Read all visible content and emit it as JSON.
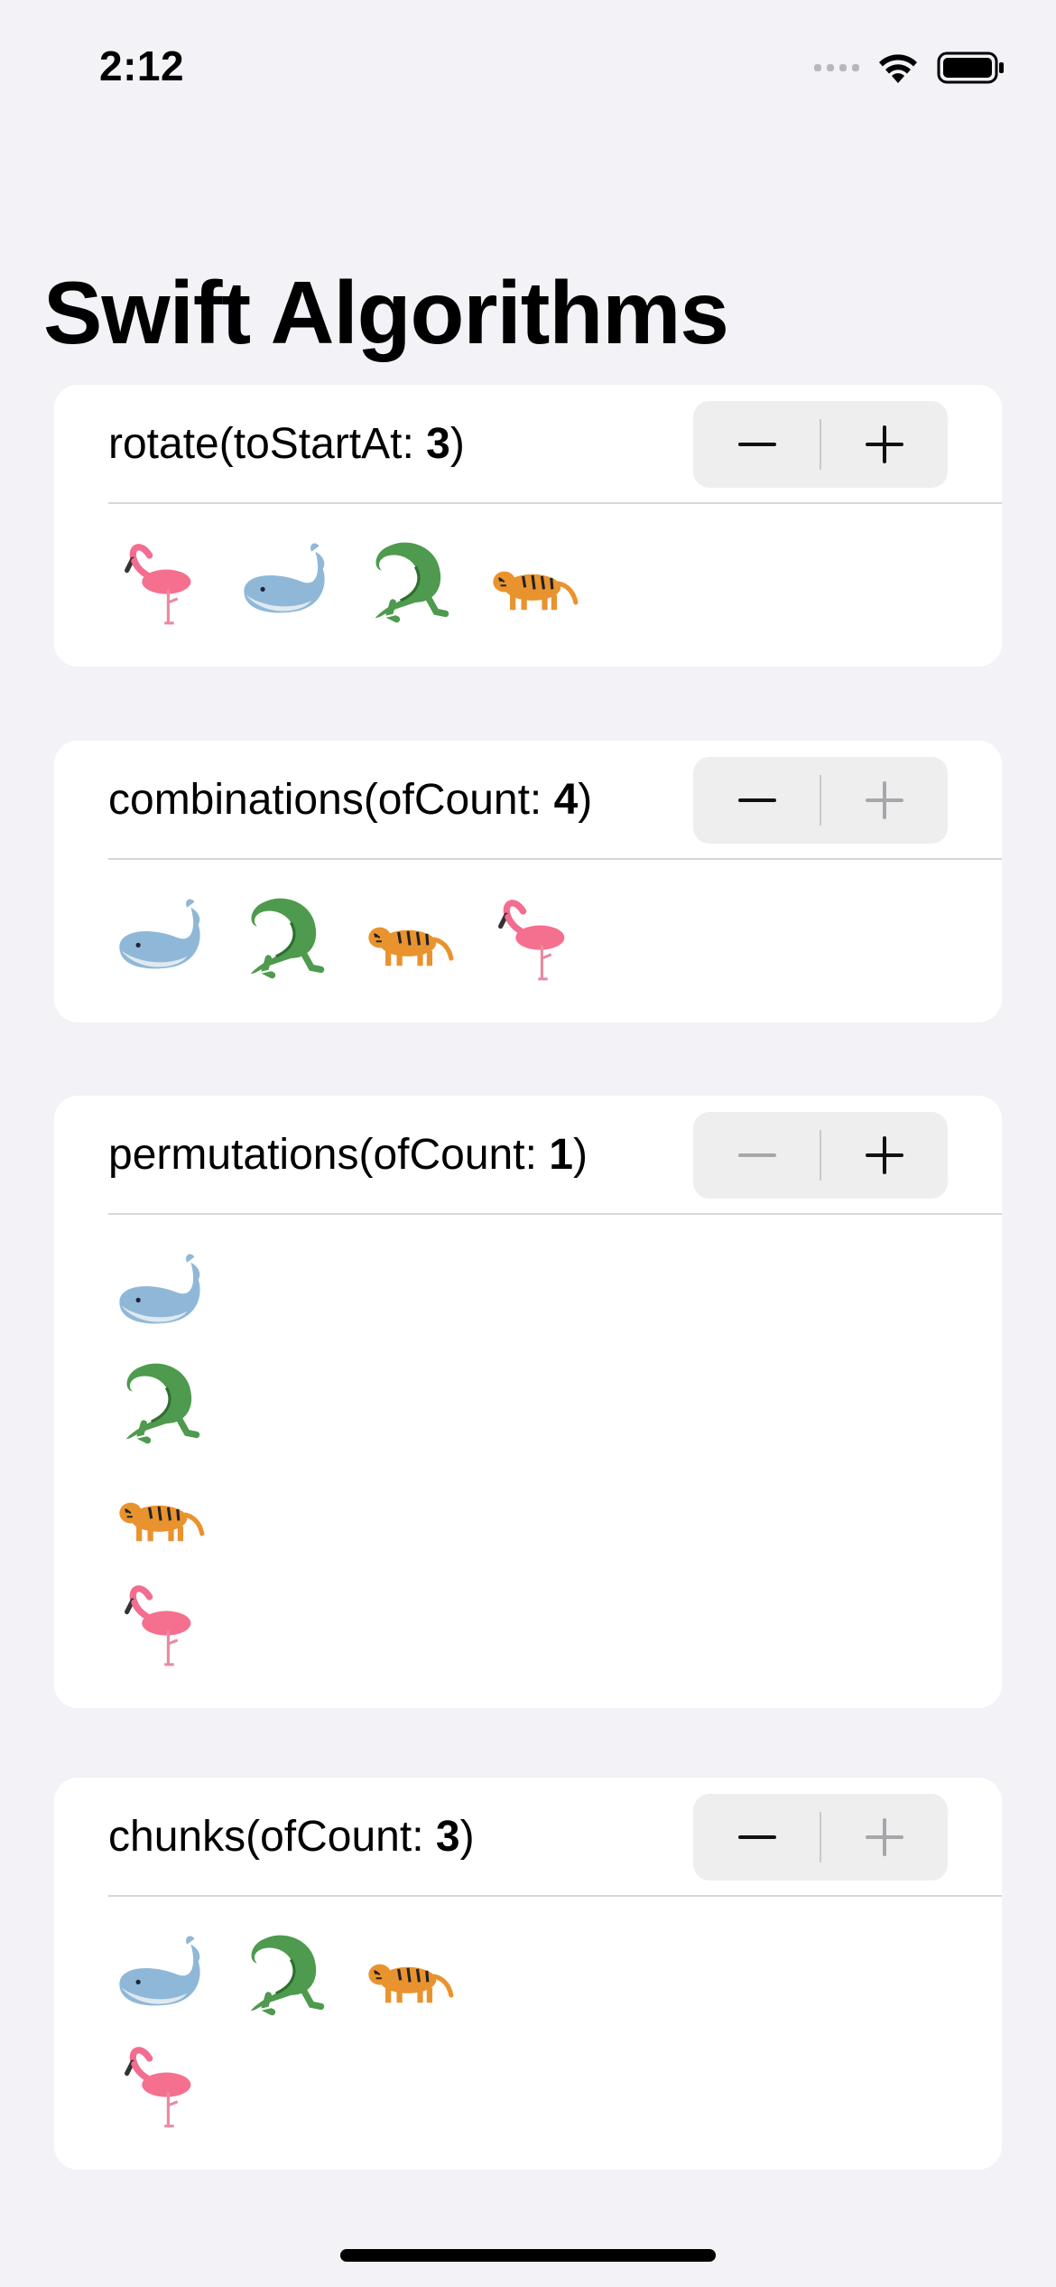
{
  "status_bar": {
    "time": "2:12"
  },
  "title": "Swift Algorithms",
  "colors": {
    "background": "#f2f2f7",
    "card": "#ffffff",
    "stepper": "#eeeeef",
    "divider": "#d6d6d9"
  },
  "cards": [
    {
      "label_prefix": "rotate(toStartAt: ",
      "value": "3",
      "label_suffix": ")",
      "decrement_enabled": true,
      "increment_enabled": true,
      "rows": [
        [
          "flamingo",
          "whale",
          "crocodile",
          "tiger"
        ]
      ]
    },
    {
      "label_prefix": "combinations(ofCount: ",
      "value": "4",
      "label_suffix": ")",
      "decrement_enabled": true,
      "increment_enabled": false,
      "rows": [
        [
          "whale",
          "crocodile",
          "tiger",
          "flamingo"
        ]
      ]
    },
    {
      "label_prefix": "permutations(ofCount: ",
      "value": "1",
      "label_suffix": ")",
      "decrement_enabled": false,
      "increment_enabled": true,
      "rows": [
        [
          "whale"
        ],
        [
          "crocodile"
        ],
        [
          "tiger"
        ],
        [
          "flamingo"
        ]
      ]
    },
    {
      "label_prefix": "chunks(ofCount: ",
      "value": "3",
      "label_suffix": ")",
      "decrement_enabled": true,
      "increment_enabled": false,
      "rows": [
        [
          "whale",
          "crocodile",
          "tiger"
        ],
        [
          "flamingo"
        ]
      ]
    }
  ]
}
